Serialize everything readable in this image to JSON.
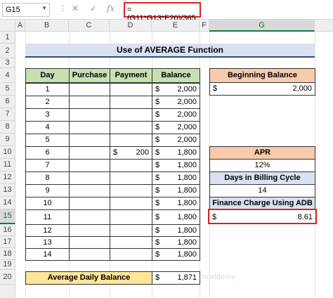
{
  "name_box": "G15",
  "formula_bar": {
    "text": "=(G11*G13*E20)/365",
    "fx_label": "fx"
  },
  "columns": [
    "A",
    "B",
    "C",
    "D",
    "E",
    "F",
    "G"
  ],
  "rows": [
    "1",
    "2",
    "3",
    "4",
    "5",
    "6",
    "7",
    "8",
    "9",
    "10",
    "11",
    "12",
    "13",
    "14",
    "15",
    "16",
    "17",
    "18",
    "19",
    "20"
  ],
  "title": "Use of AVERAGE Function",
  "table": {
    "headers": [
      "Day",
      "Purchase",
      "Payment",
      "Balance"
    ],
    "days": [
      "1",
      "2",
      "3",
      "4",
      "5",
      "6",
      "7",
      "8",
      "9",
      "10",
      "11",
      "12",
      "13",
      "14"
    ],
    "currency": "$",
    "payments": {
      "6": "200"
    },
    "balances": [
      "2,000",
      "2,000",
      "2,000",
      "2,000",
      "2,000",
      "1,800",
      "1,800",
      "1,800",
      "1,800",
      "1,800",
      "1,800",
      "1,800",
      "1,800",
      "1,800"
    ]
  },
  "summary": {
    "label": "Average Daily Balance",
    "currency": "$",
    "value": "1,871"
  },
  "side": {
    "beginning_balance_label": "Beginning Balance",
    "beginning_balance_currency": "$",
    "beginning_balance_value": "2,000",
    "apr_label": "APR",
    "apr_value": "12%",
    "days_label": "Days in Billing Cycle",
    "days_value": "14",
    "finance_label": "Finance Charge Using ADB",
    "finance_currency": "$",
    "finance_value": "8.61"
  },
  "watermark": "exceldemy",
  "colors": {
    "green": "#c6e0b4",
    "orange": "#f8cbad",
    "blue": "#d9e1f2",
    "yellow": "#ffe699",
    "highlight": "#e02020"
  }
}
